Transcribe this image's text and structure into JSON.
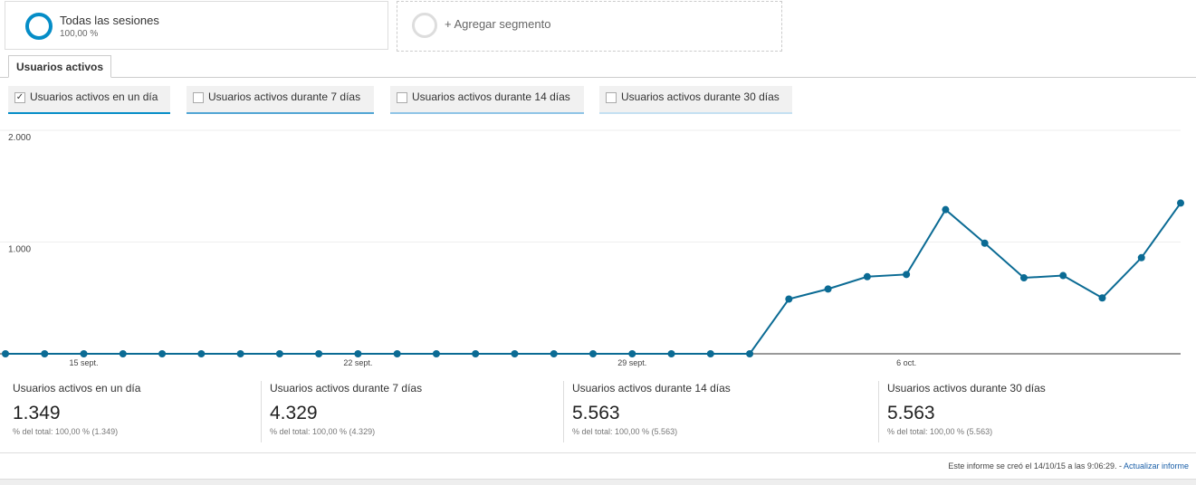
{
  "segments": {
    "primary": {
      "title": "Todas las sesiones",
      "subtitle": "100,00 %",
      "color": "#058dc7"
    },
    "add": {
      "label": "+ Agregar segmento"
    }
  },
  "tab": {
    "label": "Usuarios activos"
  },
  "metrics": [
    {
      "label": "Usuarios activos en un día",
      "checked": true,
      "check_glyph": "✓",
      "color": "#058dc7"
    },
    {
      "label": "Usuarios activos durante 7 días",
      "checked": false,
      "check_glyph": "",
      "color": "#50a5d4"
    },
    {
      "label": "Usuarios activos durante 14 días",
      "checked": false,
      "check_glyph": "",
      "color": "#8ec4e6"
    },
    {
      "label": "Usuarios activos durante 30 días",
      "checked": false,
      "check_glyph": "",
      "color": "#c4e0f2"
    }
  ],
  "chart_data": {
    "type": "line",
    "y_ticks": [
      "2.000",
      "1.000"
    ],
    "ylim": [
      0,
      2000
    ],
    "x_ticks": [
      {
        "index": 2,
        "label": "15 sept."
      },
      {
        "index": 9,
        "label": "22 sept."
      },
      {
        "index": 16,
        "label": "29 sept."
      },
      {
        "index": 23,
        "label": "6 oct."
      }
    ],
    "grid": true,
    "series": [
      {
        "color": "#0b6b94",
        "values": [
          0,
          0,
          0,
          0,
          0,
          0,
          0,
          0,
          0,
          0,
          0,
          0,
          0,
          0,
          0,
          0,
          0,
          0,
          0,
          0,
          490,
          580,
          690,
          710,
          1290,
          990,
          680,
          700,
          500,
          860,
          1349
        ]
      }
    ]
  },
  "scorecards": [
    {
      "name": "Usuarios activos en un día",
      "value": "1.349",
      "pct": "% del total: 100,00 % (1.349)"
    },
    {
      "name": "Usuarios activos durante 7 días",
      "value": "4.329",
      "pct": "% del total: 100,00 % (4.329)"
    },
    {
      "name": "Usuarios activos durante 14 días",
      "value": "5.563",
      "pct": "% del total: 100,00 % (5.563)"
    },
    {
      "name": "Usuarios activos durante 30 días",
      "value": "5.563",
      "pct": "% del total: 100,00 % (5.563)"
    }
  ],
  "footer": {
    "text": "Este informe se creó el 14/10/15 a las 9:06:29. - ",
    "link": "Actualizar informe"
  }
}
